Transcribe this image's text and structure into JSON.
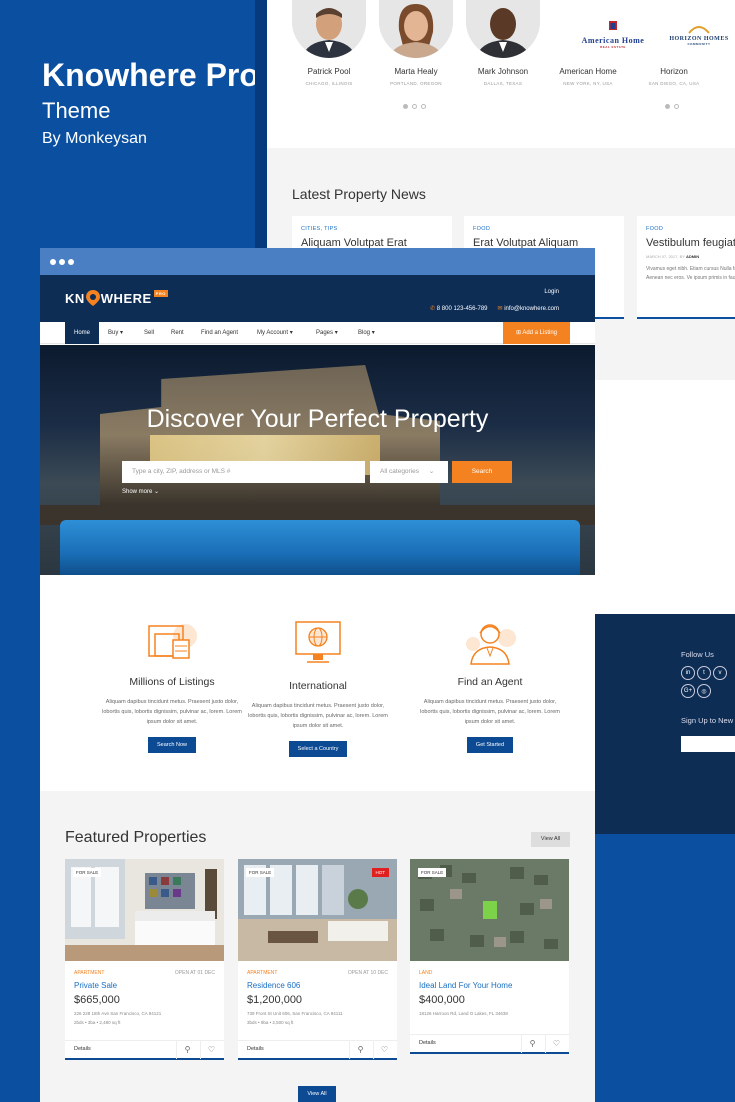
{
  "brand": {
    "title": "Knowhere Pro",
    "theme": "Theme",
    "by": "By Monkeysan"
  },
  "agents": [
    {
      "name": "Patrick Pool",
      "location": "CHICAGO, ILLINOIS"
    },
    {
      "name": "Marta Healy",
      "location": "PORTLAND, OREGON"
    },
    {
      "name": "Mark Johnson",
      "location": "DALLAS, TEXAS"
    },
    {
      "name": "American Home",
      "location": "NEW YORK, NY, USA",
      "logo": "American Home",
      "logo_sub": "REAL ESTATE"
    },
    {
      "name": "Horizon",
      "location": "SAN DIEGO, CA, USA",
      "logo": "HORIZON HOMES",
      "logo_sub": "COMMUNITY"
    }
  ],
  "news": {
    "title": "Latest Property News",
    "items": [
      {
        "category": "CITIES, TIPS",
        "title": "Aliquam Volutpat Erat"
      },
      {
        "category": "FOOD",
        "title": "Erat Volutpat Aliquam"
      },
      {
        "category": "FOOD",
        "title": "Vestibulum feugiat",
        "date": "MARCH 07, 2017, BY",
        "author": "ADMIN",
        "text": "Vivamus eget nibh. Etiam cursus Nulla facilisi. Aenean nec eros. Ve ipsum primis in faucibus."
      }
    ]
  },
  "footer": {
    "follow": "Follow Us",
    "social": [
      "in",
      "t",
      "v",
      "G+",
      "◎"
    ],
    "signup": "Sign Up to New"
  },
  "site": {
    "logo_text_left": "KN",
    "logo_text_right": "WHERE",
    "logo_badge": "PRO",
    "login": "Login",
    "phone": "8 800 123-456-789",
    "email": "info@knowhere.com",
    "nav": [
      "Home",
      "Buy",
      "Sell",
      "Rent",
      "Find an Agent",
      "My Account",
      "Pages",
      "Blog"
    ],
    "add_listing": "Add a Listing"
  },
  "hero": {
    "heading": "Discover Your Perfect Property",
    "search_placeholder": "Type a city, ZIP, address or MLS #",
    "category": "All categories",
    "search_button": "Search",
    "show_more": "Show more"
  },
  "features": [
    {
      "title": "Millions of Listings",
      "text": "Aliquam dapibus tincidunt metus. Praesent justo dolor, lobortis quis, lobortis dignissim, pulvinar ac, lorem. Lorem ipsum dolor sit amet.",
      "button": "Search Now"
    },
    {
      "title": "International",
      "text": "Aliquam dapibus tincidunt metus. Praesent justo dolor, lobortis quis, lobortis dignissim, pulvinar ac, lorem. Lorem ipsum dolor sit amet.",
      "button": "Select a Country"
    },
    {
      "title": "Find an Agent",
      "text": "Aliquam dapibus tincidunt metus. Praesent justo dolor, lobortis quis, lobortis dignissim, pulvinar ac, lorem. Lorem ipsum dolor sit amet.",
      "button": "Get Started"
    }
  ],
  "featured": {
    "title": "Featured Properties",
    "view_all": "View All",
    "view_all_bottom": "View All",
    "cards": [
      {
        "tag": "FOR SALE",
        "type": "APARTMENT",
        "open": "OPEN AT 01 DEC",
        "name": "Private Sale",
        "price": "$665,000",
        "address": "226 228 18th Ave San Francisco, CA 94121",
        "meta": "2bds  •  3ba  •  2,480 sq ft",
        "details": "Details"
      },
      {
        "tag": "FOR SALE",
        "hot": "HOT",
        "type": "APARTMENT",
        "open": "OPEN AT 10 DEC",
        "name": "Residence 606",
        "price": "$1,200,000",
        "address": "739 Front St Unit 606, San Francisco, CA 94111",
        "meta": "3bds  •  9ba  •  2,500 sq ft",
        "details": "Details"
      },
      {
        "tag": "FOR SALE",
        "type": "LAND",
        "open": "",
        "name": "Ideal Land For Your Home",
        "price": "$400,000",
        "address": "18126 Harroon Rd, Land O Lakes, FL 34638",
        "meta": "",
        "details": "Details"
      }
    ]
  }
}
